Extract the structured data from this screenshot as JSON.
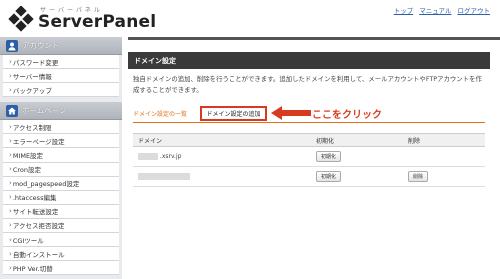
{
  "header": {
    "logo_kana": "サーバーパネル",
    "logo_name": "ServerPanel",
    "links": [
      "トップ",
      "マニュアル",
      "ログアウト"
    ]
  },
  "sidebar": {
    "account": {
      "heading": "アカウント",
      "items": [
        "パスワード変更",
        "サーバー情報",
        "バックアップ"
      ]
    },
    "homepage": {
      "heading": "ホームページ",
      "items": [
        "アクセス制限",
        "エラーページ設定",
        "MIME設定",
        "Cron設定",
        "mod_pagespeed設定",
        ".htaccess編集",
        "サイト転送設定",
        "アクセス拒否設定",
        "CGIツール",
        "自動インストール",
        "PHP Ver.切替"
      ]
    }
  },
  "main": {
    "title": "ドメイン設定",
    "description": "独自ドメインの追加、削除を行うことができます。追加したドメインを利用して、メールアカウントやFTPアカウントを作成することができます。",
    "tabs": [
      "ドメイン設定の一覧",
      "ドメイン設定の追加"
    ],
    "callout": "ここをクリック",
    "table": {
      "headers": [
        "ドメイン",
        "初期化",
        "削除"
      ],
      "rows": [
        {
          "domain": ".xsrv.jp",
          "init_label": "初期化",
          "delete_label": ""
        },
        {
          "domain": "",
          "init_label": "初期化",
          "delete_label": "削除"
        }
      ]
    }
  },
  "colors": {
    "accent": "#e0711a",
    "highlight": "#d83a1f",
    "titlebar": "#3a3a3a"
  }
}
